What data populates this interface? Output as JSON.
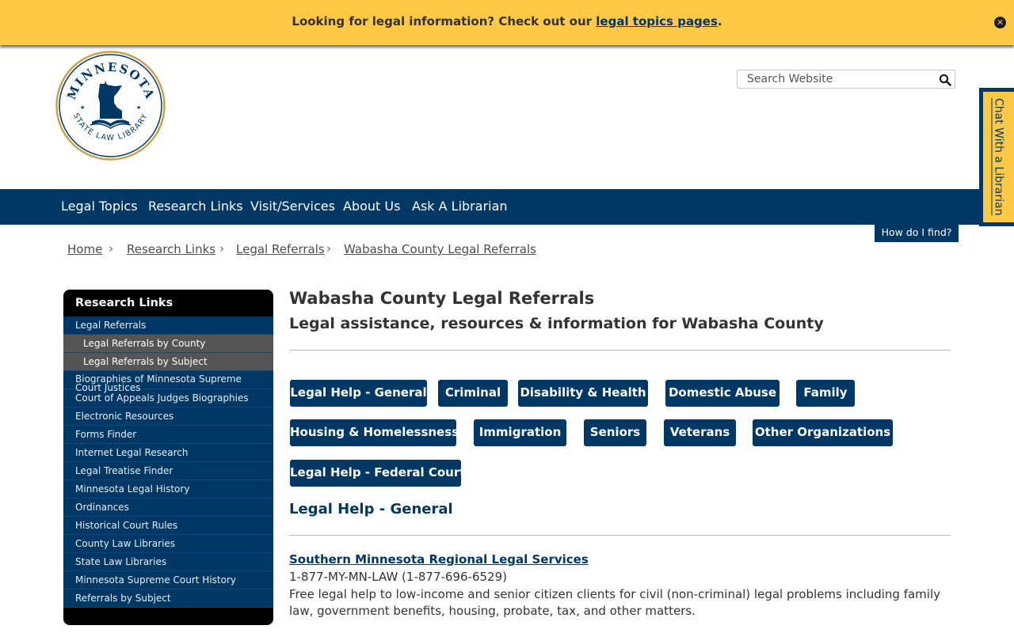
{
  "alert": {
    "text_before": "Looking for legal information? Check out our ",
    "link": "legal topics pages",
    "text_after": ".",
    "close_glyph": "✕"
  },
  "logo": {
    "top_text": "MINNESOTA",
    "bottom_text": "STATE LAW LIBRARY"
  },
  "search": {
    "placeholder": "Search Website"
  },
  "chat": {
    "label": "Chat With a Librarian"
  },
  "nav": {
    "items": [
      "Legal Topics",
      "Research Links",
      "Visit/Services",
      "About Us",
      "Ask A Librarian"
    ],
    "help_button": "How do I find?"
  },
  "breadcrumb": {
    "items": [
      "Home",
      "Research Links",
      "Legal Referrals",
      "Wabasha County Legal Referrals"
    ],
    "separator": "›"
  },
  "sidebar": {
    "title": "Research Links",
    "items": [
      "Legal Referrals",
      "Legal Referrals by County",
      "Legal Referrals by Subject",
      "Biographies of Minnesota Supreme Court Justices",
      "Court of Appeals Judges Biographies",
      "Electronic Resources",
      "Forms Finder",
      "Internet Legal Research",
      "Legal Treatise Finder",
      "Minnesota Legal History",
      "Ordinances",
      "Historical Court Rules",
      "County Law Libraries",
      "State Law Libraries",
      "Minnesota Supreme Court History",
      "Referrals by Subject"
    ]
  },
  "main": {
    "title": "Wabasha County Legal Referrals",
    "subtitle": "Legal assistance, resources & information for Wabasha County",
    "categories": [
      "Legal Help - General",
      "Criminal",
      "Disability & Health",
      "Domestic Abuse",
      "Family",
      "Housing & Homelessness",
      "Immigration",
      "Seniors",
      "Veterans",
      "Other Organizations",
      "Legal Help - Federal Court"
    ],
    "section_heading": "Legal Help - General",
    "org": {
      "name": "Southern Minnesota Regional Legal Services",
      "phone": "1-877-MY-MN-LAW (1-877-696-6529)",
      "description": "Free legal help to low-income and senior citizen clients for civil (non-criminal) legal problems including family law, government benefits, housing, probate, tax, and other matters."
    }
  },
  "colors": {
    "navy": "#003865",
    "gold": "#ffc845",
    "sidebar_sub": "#555555"
  },
  "icons": [
    "close-icon",
    "search-icon",
    "state-law-library-logo"
  ]
}
